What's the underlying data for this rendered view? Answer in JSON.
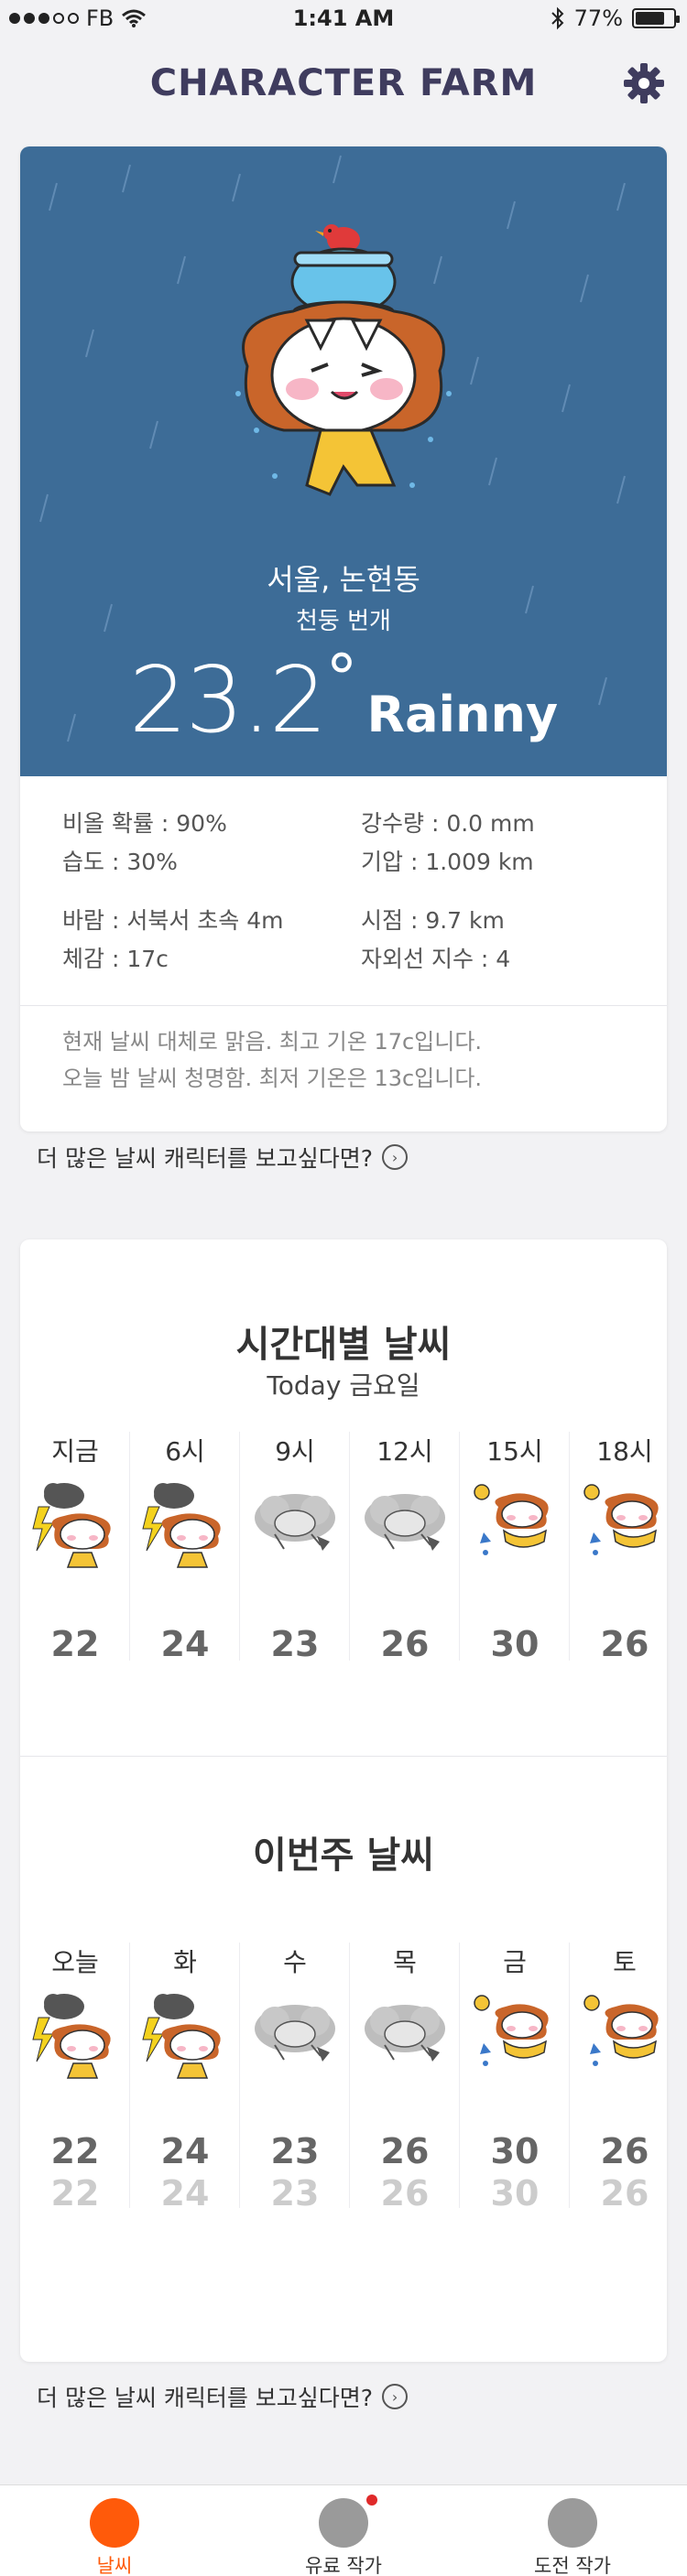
{
  "status_bar": {
    "carrier": "FB",
    "time": "1:41 AM",
    "battery": "77%",
    "battery_level": 0.77
  },
  "header": {
    "title": "CHARACTER FARM"
  },
  "current": {
    "location": "서울, 논현동",
    "condition_ko": "천둥 번개",
    "temperature": "23.2",
    "degree": "°",
    "condition": "Rainny",
    "details": [
      [
        "비올 확률 : 90%",
        "강수량 : 0.0 mm"
      ],
      [
        "습도 : 30%",
        "기압 : 1.009 km"
      ],
      [
        "바람 : 서북서 초속 4m",
        "시점 : 9.7 km"
      ],
      [
        "체감 : 17c",
        "자외선 지수 : 4"
      ]
    ],
    "summary": [
      "현재 날씨 대체로 맑음. 최고 기온 17c입니다.",
      "오늘 밤 날씨 청명함. 최저 기온은 13c입니다."
    ],
    "colors": {
      "hero_bg": "#3d6c97"
    }
  },
  "more_link": "더 많은 날씨 캐릭터를 보고싶다면?",
  "hourly": {
    "title": "시간대별 날씨",
    "subtitle": "Today 금요일",
    "items": [
      {
        "label": "지금",
        "icon": "thunder-character-icon",
        "temp": "22"
      },
      {
        "label": "6시",
        "icon": "thunder-character-icon",
        "temp": "24"
      },
      {
        "label": "9시",
        "icon": "cloudy-character-icon",
        "temp": "23"
      },
      {
        "label": "12시",
        "icon": "cloudy-character-icon",
        "temp": "26"
      },
      {
        "label": "15시",
        "icon": "sunny-character-icon",
        "temp": "30"
      },
      {
        "label": "18시",
        "icon": "sunny-character-icon",
        "temp": "26"
      }
    ]
  },
  "weekly": {
    "title": "이번주 날씨",
    "items": [
      {
        "label": "오늘",
        "icon": "thunder-character-icon",
        "high": "22",
        "low": "22"
      },
      {
        "label": "화",
        "icon": "thunder-character-icon",
        "high": "24",
        "low": "24"
      },
      {
        "label": "수",
        "icon": "cloudy-character-icon",
        "high": "23",
        "low": "23"
      },
      {
        "label": "목",
        "icon": "cloudy-character-icon",
        "high": "26",
        "low": "26"
      },
      {
        "label": "금",
        "icon": "sunny-character-icon",
        "high": "30",
        "low": "30"
      },
      {
        "label": "토",
        "icon": "sunny-character-icon",
        "high": "26",
        "low": "26"
      }
    ]
  },
  "more_link_bottom": "더 많은 날씨 캐릭터를 보고싶다면?",
  "tabs": [
    {
      "label": "날씨",
      "active": true
    },
    {
      "label": "유료 작가",
      "badge": true
    },
    {
      "label": "도전 작가"
    }
  ]
}
